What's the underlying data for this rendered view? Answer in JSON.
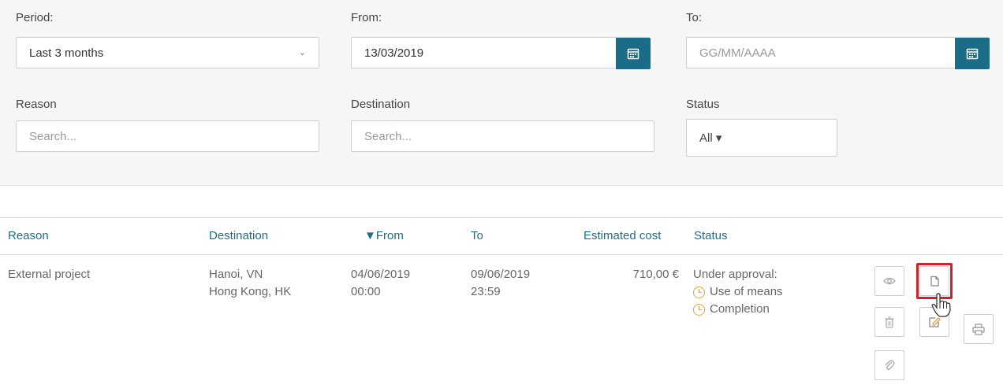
{
  "filters": {
    "period": {
      "label": "Period:",
      "value": "Last 3 months"
    },
    "from": {
      "label": "From:",
      "value": "13/03/2019"
    },
    "to": {
      "label": "To:",
      "placeholder": "GG/MM/AAAA"
    },
    "reason": {
      "label": "Reason",
      "placeholder": "Search..."
    },
    "destination": {
      "label": "Destination",
      "placeholder": "Search..."
    },
    "status": {
      "label": "Status",
      "value": "All ▾"
    }
  },
  "table": {
    "columns": [
      "Reason",
      "Destination",
      "▼From",
      "To",
      "Estimated cost",
      "Status"
    ],
    "rows": [
      {
        "reason": "External project",
        "destination_1": "Hanoi, VN",
        "destination_2": "Hong Kong, HK",
        "from_date": "04/06/2019",
        "from_time": "00:00",
        "to_date": "09/06/2019",
        "to_time": "23:59",
        "cost": "710,00 €",
        "status_title": "Under approval:",
        "status_step_1": "Use of means",
        "status_step_2": "Completion"
      }
    ]
  },
  "actions": {
    "icons": [
      "eye-icon",
      "copy-icon",
      "trash-icon",
      "edit-icon",
      "print-icon",
      "paperclip-icon"
    ]
  },
  "colors": {
    "accent": "#1b6c87",
    "header_text": "#1f6b86",
    "pending": "#e8a23c",
    "highlight": "#d0222a"
  }
}
